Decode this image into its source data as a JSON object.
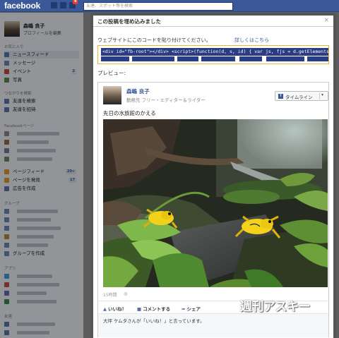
{
  "topbar": {
    "logo": "facebook",
    "notification_count": "4",
    "search_placeholder": "友達、スポット等を検索"
  },
  "sidebar": {
    "profile_name": "森嶋 良子",
    "profile_edit": "プロフィールを編集",
    "favorites_header": "お気に入り",
    "favorites": [
      {
        "label": "ニュースフィード",
        "count": ""
      },
      {
        "label": "メッセージ",
        "count": ""
      },
      {
        "label": "イベント",
        "count": "2"
      },
      {
        "label": "写真",
        "count": ""
      }
    ],
    "connect_header": "つながりを検索",
    "connect": [
      {
        "label": "友達を検索"
      },
      {
        "label": "友達を招待"
      }
    ],
    "pages_header": "Facebookページ",
    "pages": [
      {
        "label": "ページフィード",
        "count": "20+"
      },
      {
        "label": "ページを発見",
        "count": "17"
      },
      {
        "label": "広告を作成",
        "count": ""
      }
    ],
    "groups_header": "グループ",
    "groups_create": "グループを作成",
    "apps_header": "アプリ",
    "friends_header": "友達"
  },
  "dialog": {
    "title": "この投稿を埋め込みました",
    "close_glyph": "×",
    "instruction": "ウェブサイトにこのコードを貼り付けてください。",
    "details_link": "詳しくはこちら",
    "code": "<div id=\"fb-root\"></div> <script>(function(d, s, id) { var js, fjs = d.getElementsByT",
    "preview_label": "プレビュー:"
  },
  "post": {
    "author": "森嶋 良子",
    "role": "勤務先 フリー・エディター＆ライター",
    "timeline_button": "タイムライン",
    "text": "先日の水族館のかえる",
    "time": "15時間",
    "actions": {
      "like": "いいね！",
      "comment": "コメントする",
      "share": "シェア"
    },
    "likes_text": "大坪 ケムタさんが「いいね！」と言っています。"
  },
  "watermark": "週刊アスキー",
  "colors": {
    "brand": "#3b5998",
    "code_highlight": "#2a3c84",
    "codebox_border": "#e5b53d"
  }
}
